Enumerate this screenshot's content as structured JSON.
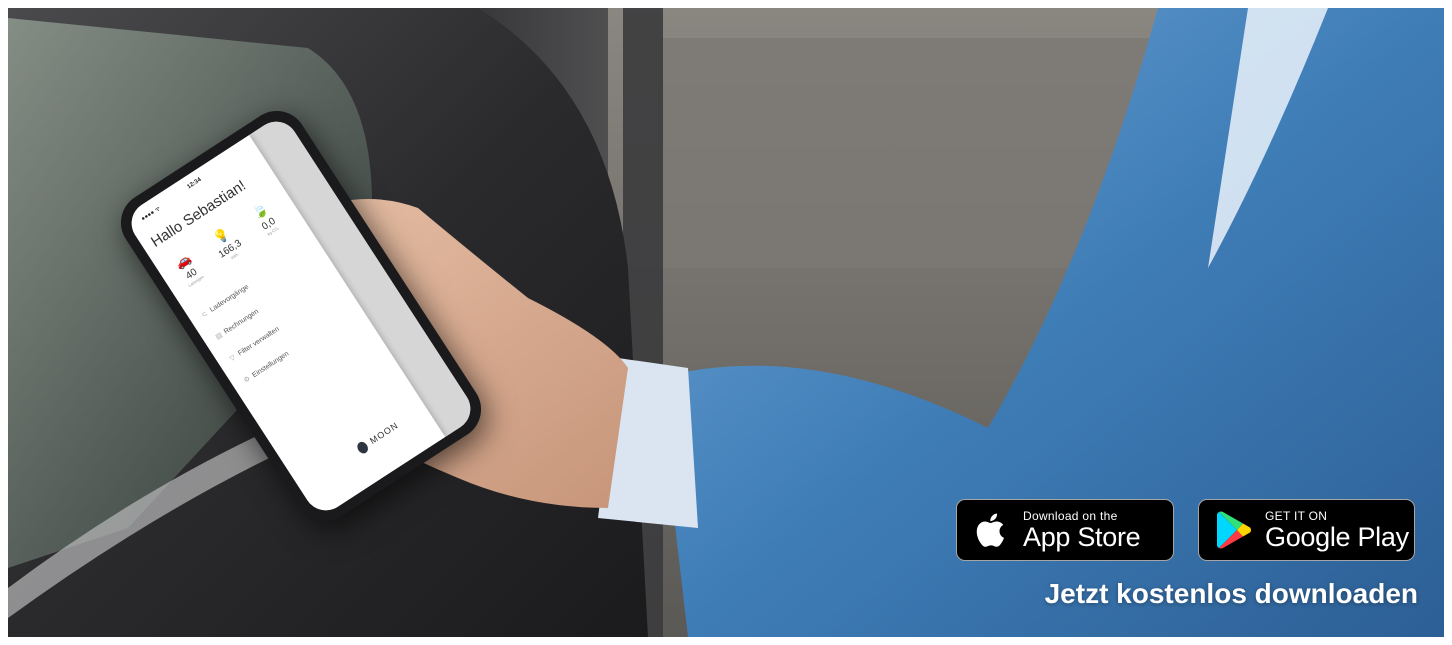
{
  "phone": {
    "status_signal": "●●●● ᯤ",
    "status_time": "12:34",
    "greeting": "Hallo Sebastian!",
    "stats": [
      {
        "icon": "car-icon",
        "glyph": "🚗",
        "value": "40",
        "unit": "Ladungen"
      },
      {
        "icon": "bulb-icon",
        "glyph": "💡",
        "value": "166,3",
        "unit": "kWh"
      },
      {
        "icon": "leaf-icon",
        "glyph": "🍃",
        "value": "0,0",
        "unit": "kg CO₂"
      }
    ],
    "menu": [
      {
        "icon": "charging-icon",
        "glyph": "⊂",
        "label": "Ladevorgänge"
      },
      {
        "icon": "invoice-icon",
        "glyph": "▤",
        "label": "Rechnungen"
      },
      {
        "icon": "filter-icon",
        "glyph": "▽",
        "label": "Filter verwalten"
      },
      {
        "icon": "settings-icon",
        "glyph": "⚙",
        "label": "Einstellungen"
      }
    ],
    "logo_text": "MOON"
  },
  "badges": {
    "appstore": {
      "small": "Download on the",
      "large": "App Store"
    },
    "googleplay": {
      "small": "GET IT ON",
      "large": "Google Play"
    }
  },
  "cta_text": "Jetzt kostenlos downloaden",
  "colors": {
    "badge_bg": "#000000",
    "badge_border": "#a6a6a6",
    "cta_text": "#ffffff"
  }
}
